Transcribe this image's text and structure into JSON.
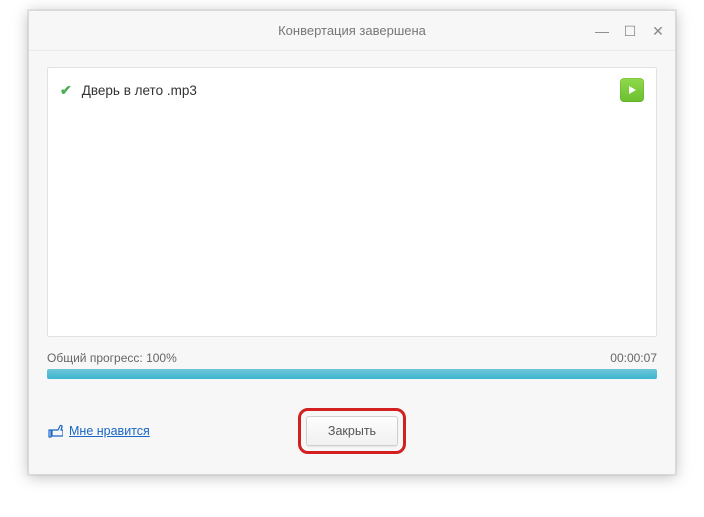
{
  "window": {
    "title": "Конвертация завершена"
  },
  "file": {
    "name": "Дверь в лето .mp3"
  },
  "progress": {
    "label": "Общий прогресс:",
    "value": "100%",
    "time": "00:00:07"
  },
  "footer": {
    "like_label": "Мне нравится",
    "close_label": "Закрыть"
  }
}
